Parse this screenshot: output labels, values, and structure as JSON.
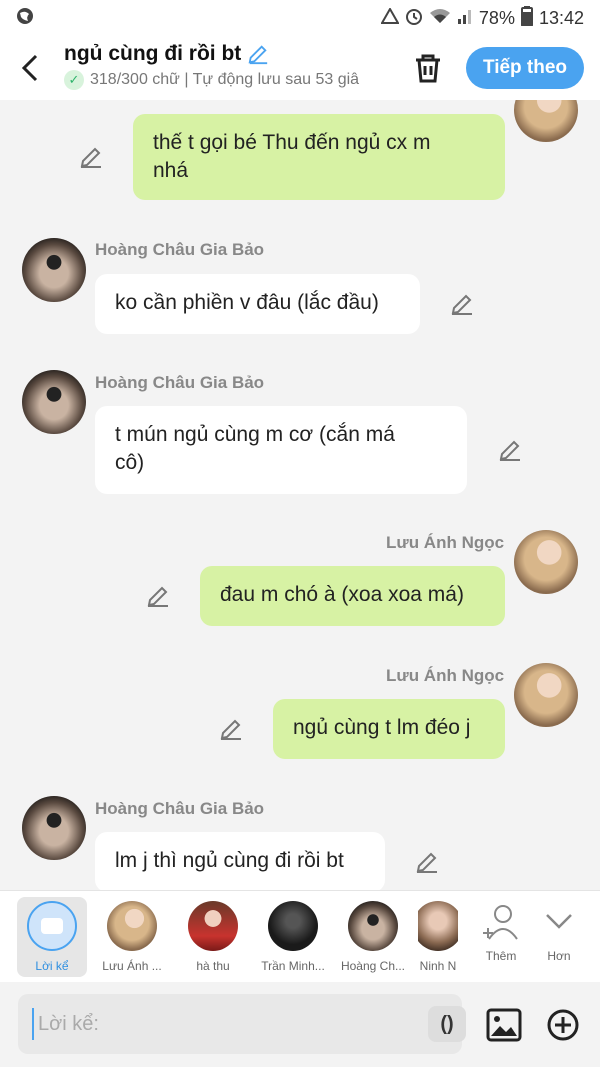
{
  "status_bar": {
    "battery": "78%",
    "time": "13:42",
    "icons": [
      "globe-icon",
      "alarm-icon",
      "wifi-icon",
      "signal-icon"
    ]
  },
  "header": {
    "title": "ngủ cùng đi rồi bt",
    "subtitle": "318/300 chữ | Tự động lưu sau 53 giâ",
    "next_label": "Tiếp theo"
  },
  "messages": [
    {
      "text_lines": [
        "thế t gọi bé Thu đến ngủ cx m",
        "nhá"
      ],
      "side": "me"
    },
    {
      "sender": "Hoàng Châu Gia Bảo",
      "text_lines": [
        "ko cần phiền v đâu (lắc đầu)"
      ],
      "side": "them"
    },
    {
      "sender": "Hoàng Châu Gia Bảo",
      "text_lines": [
        "t mún ngủ cùng m cơ (cắn má",
        "cô)"
      ],
      "side": "them"
    },
    {
      "sender": "Lưu Ánh Ngọc",
      "text_lines": [
        "đau m chó à (xoa xoa má)"
      ],
      "side": "me"
    },
    {
      "sender": "Lưu Ánh Ngọc",
      "text_lines": [
        "ngủ cùng t lm đéo j"
      ],
      "side": "me"
    },
    {
      "sender": "Hoàng Châu Gia Bảo",
      "text_lines": [
        "lm j thì ngủ cùng đi rồi bt"
      ],
      "side": "them"
    }
  ],
  "characters": [
    {
      "name": "Lời kể",
      "active": true
    },
    {
      "name": "Lưu Ánh ..."
    },
    {
      "name": "hà thu"
    },
    {
      "name": "Trần Minh..."
    },
    {
      "name": "Hoàng Ch..."
    },
    {
      "name": "Ninh N"
    }
  ],
  "actions": {
    "add_label": "Thêm",
    "more_label": "Hơn"
  },
  "input": {
    "placeholder": "Lời kể:",
    "paren_label": "()"
  },
  "colors": {
    "accent": "#4aa3f0",
    "my_bubble": "#d7f2a4",
    "their_bubble": "#ffffff"
  }
}
